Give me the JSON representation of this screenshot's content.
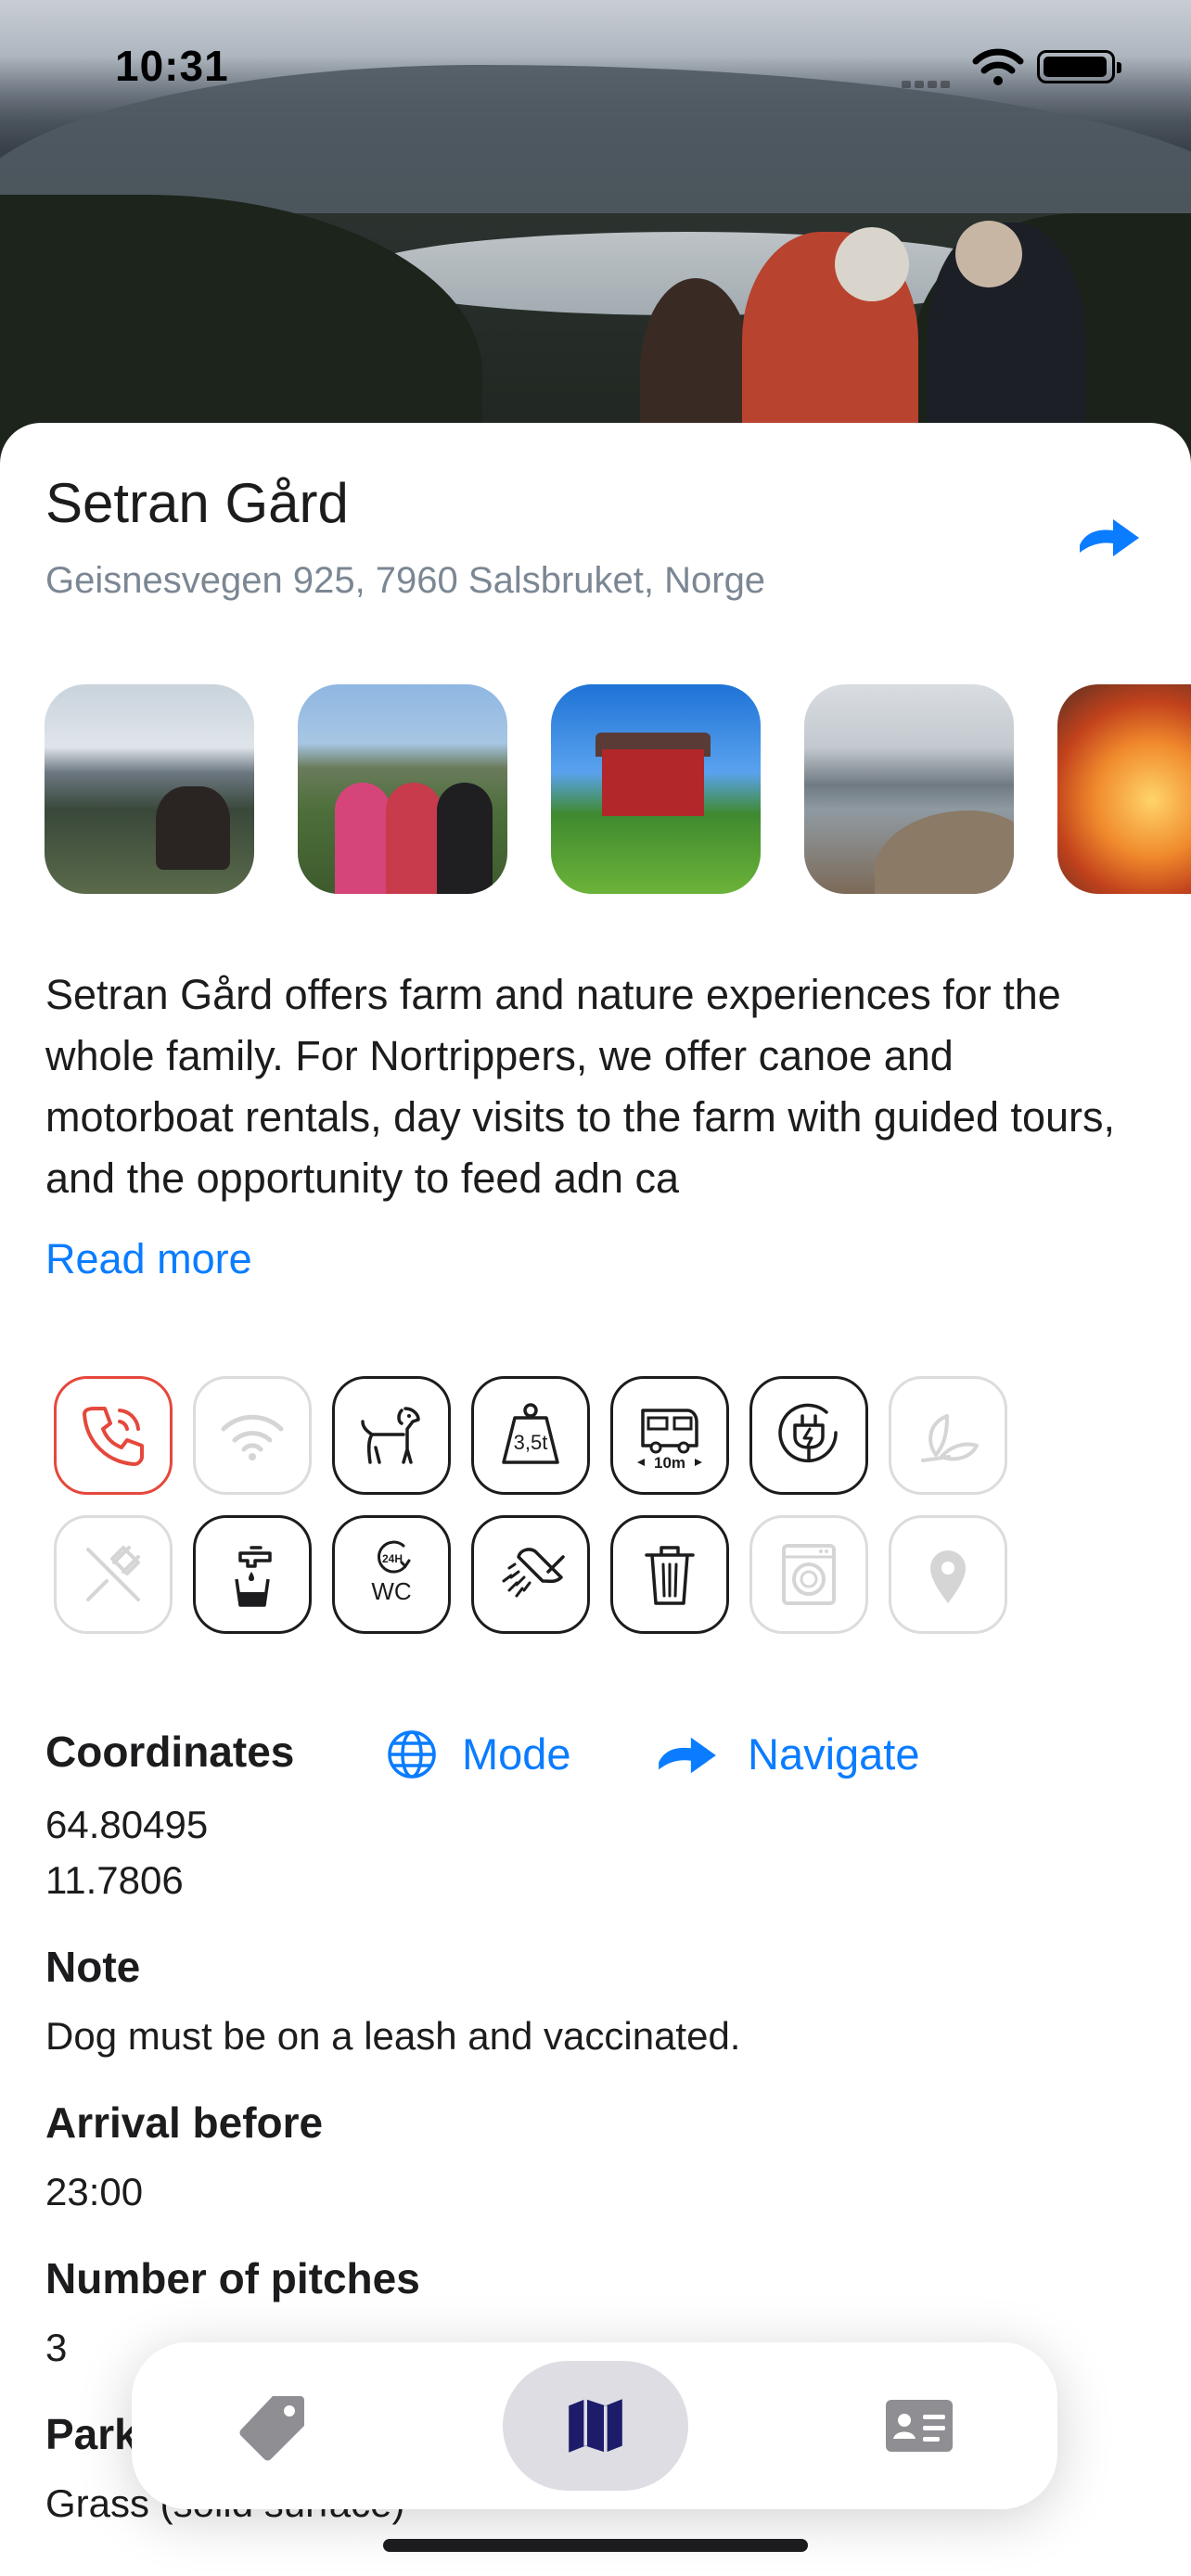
{
  "status_bar": {
    "time": "10:31"
  },
  "place": {
    "title": "Setran Gård",
    "address": "Geisnesvegen 925, 7960 Salsbruket, Norge",
    "description": "Setran Gård offers farm and nature experiences for the whole family. For Nortrippers, we offer canoe and motorboat rentals, day visits to the farm with guided tours, and the opportunity to feed adn ca",
    "read_more": "Read more"
  },
  "amenities": [
    {
      "name": "phone-icon",
      "enabled": true,
      "highlight": "#e5483c"
    },
    {
      "name": "wifi-icon",
      "enabled": false
    },
    {
      "name": "dog-icon",
      "enabled": true
    },
    {
      "name": "weight-limit-icon",
      "enabled": true,
      "label": "3,5t"
    },
    {
      "name": "motorhome-length-icon",
      "enabled": true,
      "label": "10m"
    },
    {
      "name": "electricity-icon",
      "enabled": true
    },
    {
      "name": "leaf-icon",
      "enabled": false
    },
    {
      "name": "restaurant-icon",
      "enabled": false
    },
    {
      "name": "water-tap-icon",
      "enabled": true
    },
    {
      "name": "wc-24h-icon",
      "enabled": true,
      "label": "WC",
      "sublabel": "24H"
    },
    {
      "name": "shower-icon",
      "enabled": true
    },
    {
      "name": "trash-icon",
      "enabled": true
    },
    {
      "name": "washing-machine-icon",
      "enabled": false
    },
    {
      "name": "location-pin-icon",
      "enabled": false
    }
  ],
  "details": {
    "coordinates_label": "Coordinates",
    "mode_label": "Mode",
    "navigate_label": "Navigate",
    "latitude": "64.80495",
    "longitude": "11.7806",
    "note_label": "Note",
    "note": "Dog must be on a leash and vaccinated.",
    "arrival_label": "Arrival before",
    "arrival": "23:00",
    "pitches_label": "Number of pitches",
    "pitches": "3",
    "parking_label": "Parking",
    "parking": "Grass (solid surface)"
  },
  "tabbar": {
    "tabs": [
      {
        "name": "tag-icon",
        "active": false
      },
      {
        "name": "map-icon",
        "active": true
      },
      {
        "name": "id-card-icon",
        "active": false
      }
    ]
  },
  "colors": {
    "accent": "#0a7cff",
    "secondary_text": "#7b8793",
    "disabled": "#dcdcdc"
  }
}
